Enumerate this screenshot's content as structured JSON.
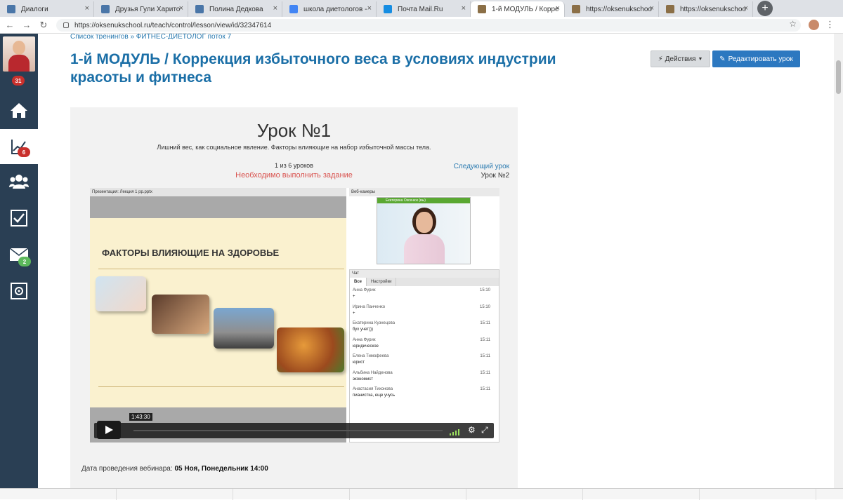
{
  "browser": {
    "tabs": [
      {
        "label": "Диалоги",
        "icon": "vk",
        "color": "#4a76a8"
      },
      {
        "label": "Друзья Гули Харито",
        "icon": "vk",
        "color": "#4a76a8"
      },
      {
        "label": "Полина Дедкова",
        "icon": "vk",
        "color": "#4a76a8"
      },
      {
        "label": "школа диетологов -",
        "icon": "google",
        "color": "#4285f4"
      },
      {
        "label": "Почта Mail.Ru",
        "icon": "mail",
        "color": "#168de2"
      },
      {
        "label": "1-й МОДУЛЬ / Корре",
        "icon": "school",
        "color": "#8b6f47"
      },
      {
        "label": "https://oksenukschoo",
        "icon": "school",
        "color": "#8b6f47"
      },
      {
        "label": "https://oksenukschoo",
        "icon": "school",
        "color": "#8b6f47"
      }
    ],
    "active_tab": 5,
    "url": "https://oksenukschool.ru/teach/control/lesson/view/id/32347614"
  },
  "sidebar": {
    "avatar_badge": "31",
    "stats_badge": "6",
    "mail_badge": "2"
  },
  "page": {
    "breadcrumb": "Список тренингов » ФИТНЕС-ДИЕТОЛОГ поток 7",
    "title": "1-й МОДУЛЬ / Коррекция избыточного веса в условиях индустрии красоты и фитнеса",
    "actions_button": "Действия",
    "edit_button": "Редактировать урок",
    "lesson": {
      "name": "Урок №1",
      "subtitle": "Лишний вес, как социальное явление. Факторы влияющие на набор избыточной массы тела.",
      "count": "1 из 6 уроков",
      "task": "Необходимо выполнить задание",
      "next_link": "Следующий урок",
      "next_name": "Урок №2"
    },
    "webinar_label": "Дата проведения вебинара:",
    "webinar_date": "05 Ноя, Понедельник 14:00"
  },
  "video": {
    "presentation_title": "Презентация: Лекция 1 pp.pptx",
    "slide_title": "ФАКТОРЫ ВЛИЯЮЩИЕ НА ЗДОРОВЬЕ",
    "webcams_title": "Веб-камеры",
    "cam_label": "Екатерина Оксенюк (вы)",
    "chat_title": "Чат",
    "chat_tabs": [
      "Все",
      "Настройки"
    ],
    "messages": [
      {
        "name": "Анна Фурик",
        "time": "15:10",
        "text": "+"
      },
      {
        "name": "Ирина Панченко",
        "time": "15:10",
        "text": "+"
      },
      {
        "name": "Екатерина Кузнецова",
        "time": "15:11",
        "text": "бух учет)))"
      },
      {
        "name": "Анна Фурик",
        "time": "15:11",
        "text": "юридическое"
      },
      {
        "name": "Елена Тимофеева",
        "time": "15:11",
        "text": "юрист"
      },
      {
        "name": "Альбина Найденова",
        "time": "15:11",
        "text": "экономист"
      },
      {
        "name": "Анастасия Тихонова",
        "time": "15:11",
        "text": "пианистка, еще учусь"
      }
    ],
    "time": "1:43:30"
  }
}
